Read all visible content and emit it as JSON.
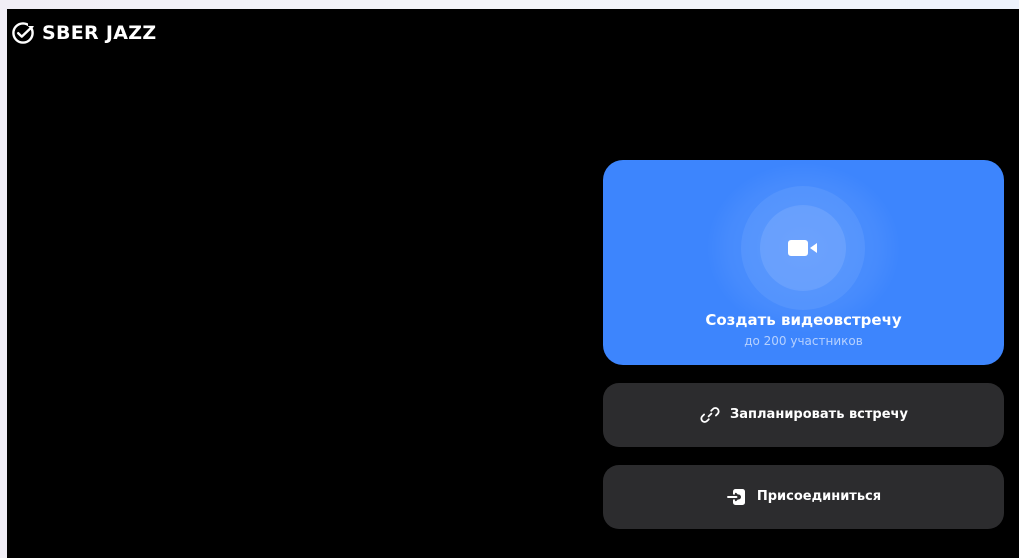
{
  "app": {
    "brand": "SBER JAZZ",
    "logo_icon": "sber-checkmark-icon"
  },
  "create_meeting": {
    "title": "Создать видеовстречу",
    "subtitle": "до 200 участников",
    "icon": "video-camera-icon",
    "color": "#3d85fd"
  },
  "schedule_meeting": {
    "label": "Запланировать встречу",
    "icon": "link-icon"
  },
  "join_meeting": {
    "label": "Присоединиться",
    "icon": "enter-icon"
  },
  "colors": {
    "window_background": "#000000",
    "secondary_button": "#2c2c2e",
    "text": "#ffffff"
  }
}
